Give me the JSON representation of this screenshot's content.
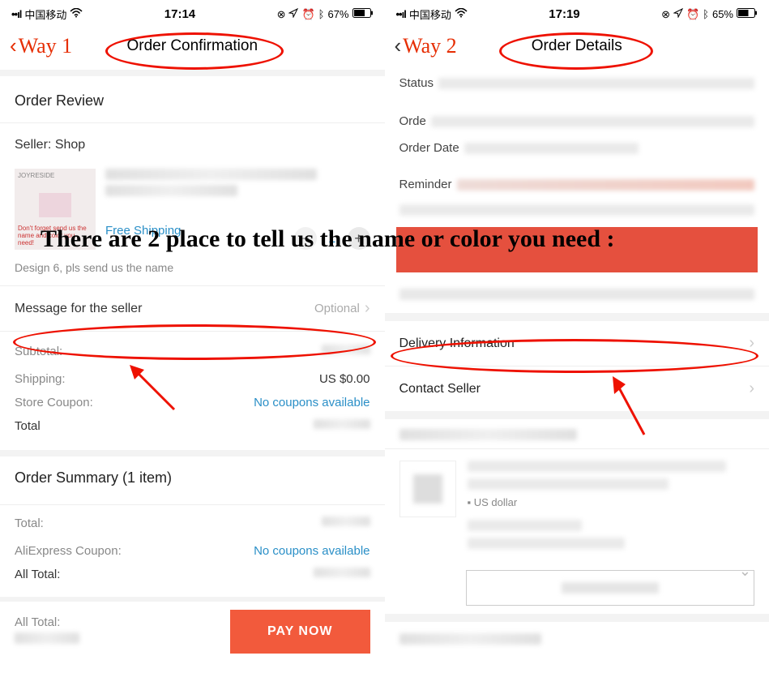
{
  "annotation": {
    "way1": "Way 1",
    "way2": "Way 2",
    "big_text": "There are 2 place to tell us the name or color you need :"
  },
  "left": {
    "status": {
      "carrier": "中国移动",
      "time": "17:14",
      "battery": "67%"
    },
    "title": "Order Confirmation",
    "order_review": "Order Review",
    "seller_label": "Seller:",
    "seller_name": "Shop",
    "thumb_brand": "JOYRESIDE",
    "thumb_note": "Don't forget send us the name and color you need!",
    "free_shipping": "Free Shipping",
    "qty": "1",
    "variant_note": "Design 6, pls send us the name",
    "msg_seller": "Message for the seller",
    "optional": "Optional",
    "subtotal_k": "Subtotal:",
    "shipping_k": "Shipping:",
    "shipping_v": "US $0.00",
    "coupon_k": "Store Coupon:",
    "coupon_v": "No coupons available",
    "total_k": "Total",
    "summary_hdr": "Order Summary (1 item)",
    "sum_total_k": "Total:",
    "ali_coupon_k": "AliExpress Coupon:",
    "ali_coupon_v": "No coupons available",
    "all_total_k": "All Total:",
    "all_total2_k": "All Total:",
    "pay_btn": "PAY NOW"
  },
  "right": {
    "status": {
      "carrier": "中国移动",
      "time": "17:19",
      "battery": "65%"
    },
    "title": "Order Details",
    "status_k": "Status",
    "order_k": "Orde",
    "orderdate_k": "Order Date",
    "reminder_k": "Reminder",
    "delivery": "Delivery Information",
    "contact": "Contact Seller",
    "usd": "US dollar"
  }
}
